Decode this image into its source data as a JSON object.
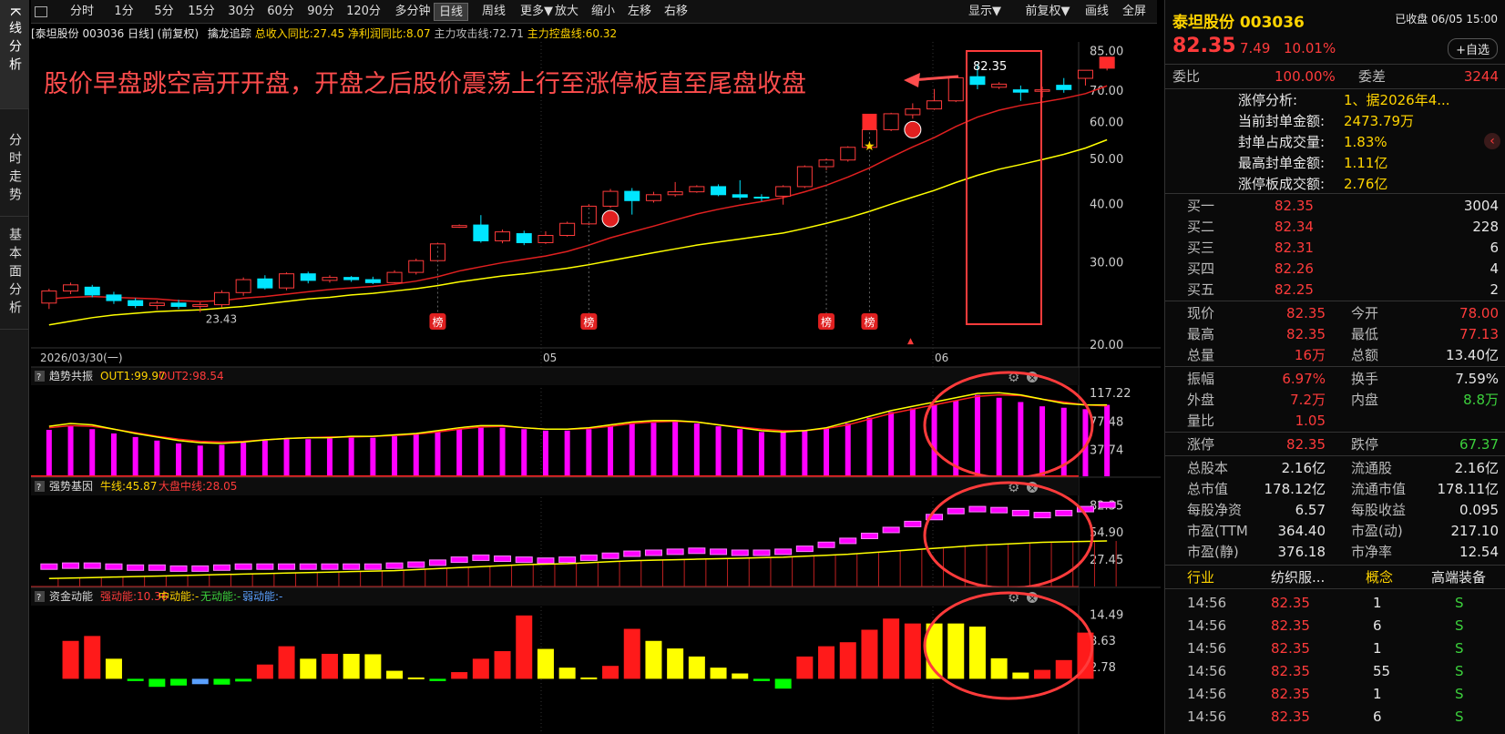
{
  "tabs": {
    "t1": "K线分析",
    "t2": "分时走势",
    "t3": "基本面分析"
  },
  "toolbar": {
    "items": [
      "分时",
      "1分",
      "5分",
      "15分",
      "30分",
      "60分",
      "90分",
      "120分",
      "多分钟",
      "日线",
      "周线",
      "更多▼",
      "放大",
      "缩小",
      "左移",
      "右移"
    ],
    "right": [
      "显示▼",
      "前复权▼",
      "画线",
      "全屏"
    ]
  },
  "info": {
    "stock": "[泰坦股份 003036 日线]",
    "adj": "(前复权)",
    "ind": "擒龙追踪",
    "v1": "总收入同比:27.45",
    "v2": "净利润同比:8.07",
    "v3": "主力攻击线:72.71",
    "v4": "主力控盘线:60.32"
  },
  "annotation": "股价早盘跳空高开开盘，开盘之后股价震荡上行至涨停板直至尾盘收盘",
  "price_label": "82.35",
  "low_label": "23.43",
  "bang": "榜",
  "xaxis": {
    "start": "2026/03/30(一)",
    "m1": "05",
    "m2": "06"
  },
  "yaxis": [
    "85.00",
    "70.00",
    "60.00",
    "50.00",
    "40.00",
    "30.00",
    "20.00"
  ],
  "panels": {
    "p1": {
      "name": "趋势共振",
      "a": "OUT1:99.97",
      "b": "OUT2:98.54",
      "ticks": [
        "117.22",
        "77.48",
        "37.74"
      ]
    },
    "p2": {
      "name": "强势基因",
      "a": "牛线:45.87",
      "b": "大盘中线:28.05",
      "ticks": [
        "82.35",
        "54.90",
        "27.45"
      ]
    },
    "p3": {
      "name": "资金动能",
      "a": "强动能:10.36",
      "b": "中动能:-",
      "c": "无动能:-",
      "d": "弱动能:-",
      "ticks": [
        "14.49",
        "8.63",
        "2.78"
      ]
    }
  },
  "chart_data": {
    "type": "candlestick",
    "title": "泰坦股份 003036 日线",
    "ylim": [
      20,
      88
    ],
    "candles": [
      [
        24.5,
        26,
        23.8,
        26.3
      ],
      [
        26,
        26.8,
        25.6,
        27.1
      ],
      [
        26.5,
        25.5,
        25.2,
        26.8
      ],
      [
        25.5,
        24.8,
        24.4,
        25.9
      ],
      [
        24.8,
        24.2,
        23.9,
        25.1
      ],
      [
        24.2,
        24.5,
        23.7,
        24.8
      ],
      [
        24.5,
        24.1,
        23.8,
        24.9
      ],
      [
        24.1,
        24.3,
        23.43,
        24.6
      ],
      [
        24.3,
        25.8,
        24,
        26.1
      ],
      [
        25.8,
        27.5,
        25.4,
        27.8
      ],
      [
        27.6,
        26.4,
        26.2,
        28.1
      ],
      [
        26.4,
        28.3,
        26.1,
        28.5
      ],
      [
        28.3,
        27.4,
        27,
        28.6
      ],
      [
        27.4,
        27.8,
        27.1,
        28.1
      ],
      [
        27.8,
        27.5,
        27.2,
        28
      ],
      [
        27.5,
        27.1,
        26.9,
        27.9
      ],
      [
        27.1,
        28.5,
        27,
        28.8
      ],
      [
        28.5,
        30.2,
        28.2,
        30.5
      ],
      [
        30.2,
        32.8,
        30,
        33
      ],
      [
        35.6,
        35.9,
        35.5,
        36.1
      ],
      [
        36,
        33.3,
        33,
        37.8
      ],
      [
        33.3,
        34.8,
        32.9,
        35.2
      ],
      [
        34.5,
        33,
        32.6,
        35
      ],
      [
        33,
        34.2,
        32.8,
        34.9
      ],
      [
        34.2,
        36.3,
        34,
        36.6
      ],
      [
        36.2,
        39.5,
        36,
        39.9
      ],
      [
        39.5,
        42.5,
        39.2,
        43
      ],
      [
        42.5,
        40.6,
        37.9,
        43.2
      ],
      [
        40.6,
        41.8,
        40.2,
        42.4
      ],
      [
        41.8,
        42.4,
        41.4,
        44.5
      ],
      [
        42.4,
        43.5,
        42.2,
        43.8
      ],
      [
        43.5,
        41.8,
        41.5,
        44
      ],
      [
        41.8,
        41.3,
        40.8,
        44.9
      ],
      [
        41.3,
        41.2,
        40.5,
        41.9
      ],
      [
        41.5,
        43.5,
        39.8,
        43.8
      ],
      [
        43.5,
        48,
        43.2,
        48.3
      ],
      [
        48,
        49.6,
        47.2,
        50
      ],
      [
        49.6,
        52.8,
        49.2,
        53.1
      ],
      [
        52.8,
        57.6,
        52.4,
        57.9
      ],
      [
        57.6,
        62.3,
        57.2,
        62.6
      ],
      [
        62,
        63.8,
        60.8,
        65.6
      ],
      [
        63.8,
        66.4,
        63.5,
        70.4
      ],
      [
        66.4,
        74.4,
        66,
        74.8
      ],
      [
        74.8,
        72,
        70.3,
        79.7
      ],
      [
        71,
        72.1,
        70.4,
        72.8
      ],
      [
        70.1,
        69.3,
        66.4,
        71.6
      ],
      [
        69.6,
        70.1,
        67.5,
        71.2
      ],
      [
        71.7,
        70.2,
        69.1,
        74.3
      ],
      [
        74.2,
        77.2,
        71.6,
        76.6
      ],
      [
        78,
        82.35,
        77.13,
        82.35
      ]
    ],
    "ma_red": [
      25,
      25.2,
      25.3,
      25.2,
      25.1,
      25,
      24.8,
      24.7,
      24.8,
      25.1,
      25.3,
      25.6,
      25.9,
      26.2,
      26.4,
      26.6,
      26.9,
      27.3,
      27.9,
      28.7,
      29.3,
      29.9,
      30.4,
      30.9,
      31.6,
      32.6,
      33.8,
      34.8,
      35.8,
      36.9,
      38,
      38.9,
      39.7,
      40.4,
      41.2,
      42.4,
      43.8,
      45.6,
      47.7,
      50.3,
      52.9,
      55.4,
      58.5,
      61.3,
      63.4,
      64.9,
      66,
      67.2,
      68.8,
      71.5
    ],
    "ma_yellow": [
      22,
      22.4,
      22.8,
      23.1,
      23.3,
      23.5,
      23.6,
      23.7,
      23.9,
      24.1,
      24.4,
      24.7,
      25,
      25.2,
      25.5,
      25.7,
      26,
      26.3,
      26.7,
      27.2,
      27.6,
      28,
      28.3,
      28.7,
      29.1,
      29.6,
      30.2,
      30.8,
      31.4,
      32,
      32.6,
      33.1,
      33.6,
      34.1,
      34.6,
      35.4,
      36.3,
      37.3,
      38.5,
      39.9,
      41.3,
      42.7,
      44.4,
      46,
      47.4,
      48.5,
      49.7,
      51,
      52.6,
      54.8
    ],
    "p1_bars": [
      65,
      70,
      66,
      60,
      55,
      50,
      46,
      43,
      44,
      47,
      50,
      52,
      52,
      53,
      54,
      54,
      56,
      59,
      62,
      66,
      68,
      68,
      66,
      64,
      64,
      66,
      70,
      74,
      75,
      76,
      74,
      70,
      66,
      62,
      62,
      64,
      68,
      74,
      82,
      90,
      95,
      100,
      106,
      114,
      110,
      104,
      98,
      96,
      94,
      100
    ],
    "p1_out1": [
      70,
      74,
      72,
      66,
      60,
      55,
      50,
      47,
      46,
      48,
      51,
      53,
      54,
      54,
      56,
      56,
      58,
      60,
      64,
      68,
      71,
      71,
      68,
      66,
      66,
      68,
      72,
      76,
      78,
      78,
      76,
      72,
      68,
      64,
      62,
      64,
      68,
      76,
      84,
      92,
      98,
      104,
      110,
      116,
      117,
      114,
      108,
      102,
      100,
      99.97
    ],
    "p1_out2": [
      68,
      71,
      70,
      66,
      61,
      56,
      52,
      49,
      48,
      49,
      51,
      53,
      54,
      55,
      55,
      56,
      57,
      59,
      62,
      66,
      69,
      70,
      68,
      66,
      66,
      67,
      70,
      74,
      76,
      77,
      76,
      72,
      69,
      66,
      64,
      64,
      67,
      72,
      80,
      88,
      94,
      100,
      106,
      112,
      114,
      113,
      108,
      104,
      100,
      98.54
    ],
    "p2_vals": [
      20,
      21,
      21,
      20,
      19,
      19,
      18,
      18,
      19,
      20,
      20,
      20,
      20,
      20,
      20,
      20,
      21,
      22,
      24,
      27,
      29,
      28,
      27,
      26,
      27,
      29,
      31,
      33,
      34,
      35,
      36,
      35,
      34,
      34,
      35,
      38,
      42,
      46,
      51,
      57,
      63,
      70,
      76,
      78,
      77,
      74,
      72,
      74,
      78,
      82.35
    ],
    "p2_line": [
      8,
      8.5,
      9,
      9.5,
      10,
      10.5,
      11,
      11.5,
      12,
      12.5,
      13,
      13.5,
      14,
      14.5,
      15,
      15.5,
      16,
      17,
      18,
      19,
      20,
      21,
      22,
      22.5,
      23,
      24,
      25,
      26,
      26.5,
      27,
      27.5,
      28,
      28.5,
      29,
      29.5,
      30.5,
      31.5,
      32.5,
      34,
      35.5,
      37,
      38.5,
      40,
      41.5,
      42.5,
      43.5,
      44.5,
      45,
      45.5,
      45.87
    ],
    "p3_vals": [
      8.5,
      9.6,
      4.5,
      -0.5,
      -1.8,
      -1.5,
      -1.2,
      -1.3,
      -0.6,
      3.2,
      7.3,
      4.5,
      5.6,
      5.6,
      5.5,
      1.8,
      0.3,
      -0.5,
      1.5,
      4.5,
      6.2,
      14.2,
      6.7,
      2.5,
      0.3,
      2.9,
      11.2,
      8.5,
      6.8,
      5,
      2.5,
      1.2,
      -0.5,
      -2.2,
      5,
      7.3,
      8.2,
      11,
      13.5,
      12.4,
      12.4,
      12.4,
      11.7,
      4.6,
      1.4,
      2,
      4.2,
      10.36
    ],
    "p3_colors": [
      "red",
      "red",
      "yellow",
      "green",
      "green",
      "green",
      "blue",
      "green",
      "green",
      "red",
      "red",
      "yellow",
      "red",
      "yellow",
      "yellow",
      "yellow",
      "yellow",
      "green",
      "red",
      "red",
      "red",
      "red",
      "yellow",
      "yellow",
      "yellow",
      "red",
      "red",
      "yellow",
      "yellow",
      "yellow",
      "yellow",
      "yellow",
      "green",
      "green",
      "red",
      "red",
      "red",
      "red",
      "red",
      "red",
      "yellow",
      "yellow",
      "yellow",
      "yellow",
      "yellow",
      "red",
      "red",
      "red"
    ]
  },
  "right": {
    "title": "泰坦股份 003036",
    "status": "已收盘 06/05 15:00",
    "price": "82.35",
    "chg": "7.49",
    "pct": "10.01%",
    "watch": "+自选",
    "webi_l": "委比",
    "webi_v": "100.00%",
    "wecha_l": "委差",
    "wecha_v": "3244",
    "zt": [
      [
        "涨停分析:",
        "1、据2026年4..."
      ],
      [
        "当前封单金额:",
        "2473.79万"
      ],
      [
        "封单占成交量:",
        "1.83%"
      ],
      [
        "最高封单金额:",
        "1.11亿"
      ],
      [
        "涨停板成交额:",
        "2.76亿"
      ]
    ],
    "buy": [
      [
        "买一",
        "82.35",
        "3004"
      ],
      [
        "买二",
        "82.34",
        "228"
      ],
      [
        "买三",
        "82.31",
        "6"
      ],
      [
        "买四",
        "82.26",
        "4"
      ],
      [
        "买五",
        "82.25",
        "2"
      ]
    ],
    "q1": [
      [
        "现价",
        "82.35",
        "今开",
        "78.00"
      ],
      [
        "最高",
        "82.35",
        "最低",
        "77.13"
      ],
      [
        "总量",
        "16万",
        "总额",
        "13.40亿"
      ]
    ],
    "q2": [
      [
        "振幅",
        "6.97%",
        "换手",
        "7.59%"
      ],
      [
        "外盘",
        "7.2万",
        "内盘",
        "8.8万"
      ],
      [
        "量比",
        "1.05",
        "",
        ""
      ]
    ],
    "q3": [
      [
        "涨停",
        "82.35",
        "跌停",
        "67.37"
      ]
    ],
    "q4": [
      [
        "总股本",
        "2.16亿",
        "流通股",
        "2.16亿"
      ],
      [
        "总市值",
        "178.12亿",
        "流通市值",
        "178.11亿"
      ],
      [
        "每股净资",
        "6.57",
        "每股收益",
        "0.095"
      ],
      [
        "市盈(TTM",
        "364.40",
        "市盈(动)",
        "217.10"
      ],
      [
        "市盈(静)",
        "376.18",
        "市净率",
        "12.54"
      ]
    ],
    "ind": [
      "行业",
      "纺织服...",
      "概念",
      "高端装备"
    ],
    "trades": [
      [
        "14:56",
        "82.35",
        "1",
        "S"
      ],
      [
        "14:56",
        "82.35",
        "6",
        "S"
      ],
      [
        "14:56",
        "82.35",
        "1",
        "S"
      ],
      [
        "14:56",
        "82.35",
        "55",
        "S"
      ],
      [
        "14:56",
        "82.35",
        "1",
        "S"
      ],
      [
        "14:56",
        "82.35",
        "6",
        "S"
      ]
    ]
  }
}
